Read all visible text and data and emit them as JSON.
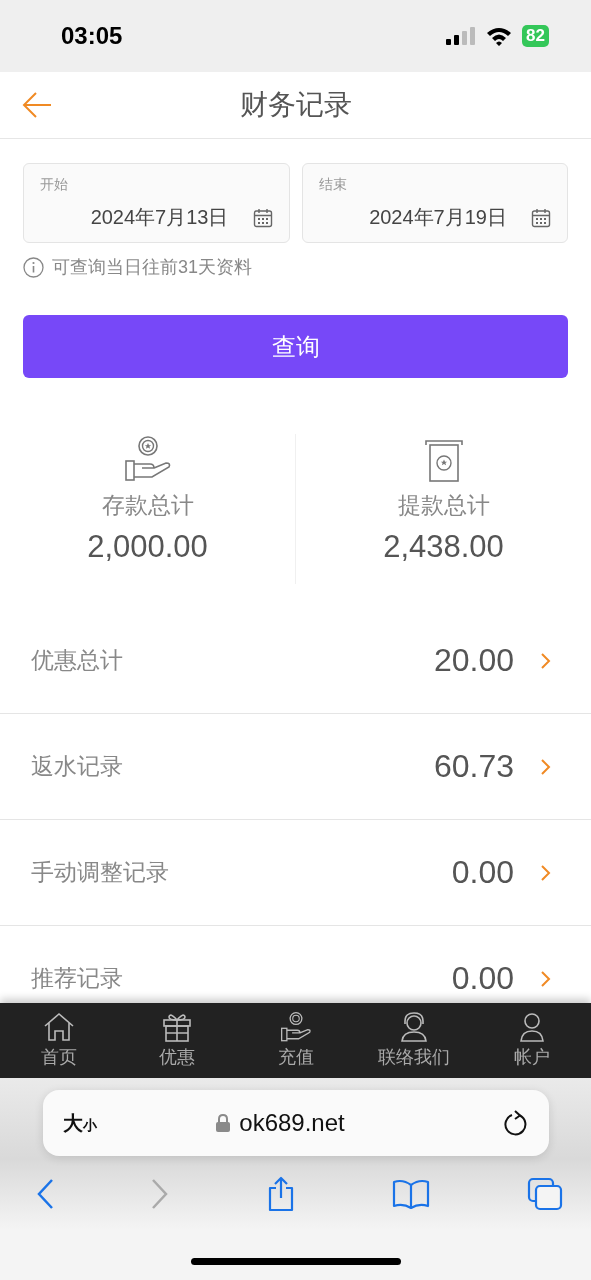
{
  "status_bar": {
    "time": "03:05",
    "battery": "82"
  },
  "header": {
    "title": "财务记录"
  },
  "date_range": {
    "start": {
      "label": "开始",
      "value": "2024年7月13日"
    },
    "end": {
      "label": "结束",
      "value": "2024年7月19日"
    },
    "note": "可查询当日往前31天资料"
  },
  "query_button": "查询",
  "totals": [
    {
      "kind": "deposit",
      "label": "存款总计",
      "value": "2,000.00"
    },
    {
      "kind": "withdraw",
      "label": "提款总计",
      "value": "2,438.00"
    }
  ],
  "records": [
    {
      "label": "优惠总计",
      "value": "20.00"
    },
    {
      "label": "返水记录",
      "value": "60.73"
    },
    {
      "label": "手动调整记录",
      "value": "0.00"
    },
    {
      "label": "推荐记录",
      "value": "0.00"
    }
  ],
  "tab_bar": [
    {
      "kind": "home",
      "label": "首页"
    },
    {
      "kind": "gift",
      "label": "优惠"
    },
    {
      "kind": "deposit",
      "label": "充值"
    },
    {
      "kind": "support",
      "label": "联络我们"
    },
    {
      "kind": "account",
      "label": "帐户"
    }
  ],
  "browser": {
    "text_size": "大",
    "text_size_small": "小",
    "url": "ok689.net",
    "back_disabled": false,
    "forward_disabled": true
  }
}
